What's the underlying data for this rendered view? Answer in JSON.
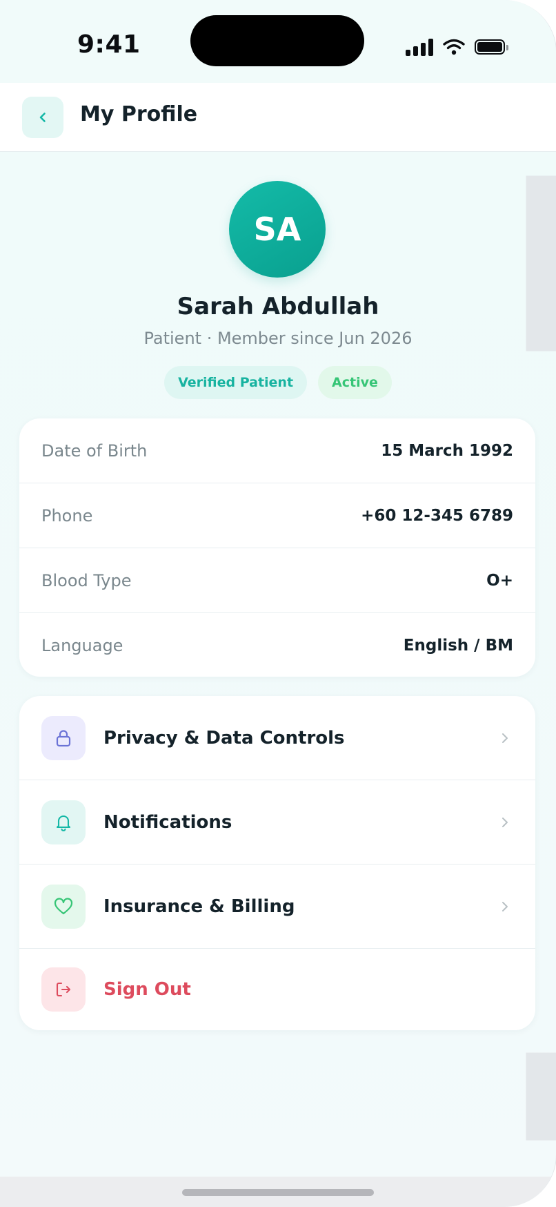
{
  "status_bar": {
    "time": "9:41"
  },
  "header": {
    "title": "My Profile"
  },
  "profile": {
    "initials": "SA",
    "name": "Sarah Abdullah",
    "subtitle": "Patient · Member since Jun 2026",
    "badges": {
      "verified": "Verified Patient",
      "active": "Active"
    }
  },
  "info": {
    "rows": [
      {
        "label": "Date of Birth",
        "value": "15 March 1992"
      },
      {
        "label": "Phone",
        "value": "+60 12-345 6789"
      },
      {
        "label": "Blood Type",
        "value": "O+"
      },
      {
        "label": "Language",
        "value": "English / BM"
      }
    ]
  },
  "menu": {
    "items": [
      {
        "label": "Privacy & Data Controls",
        "icon": "lock-icon"
      },
      {
        "label": "Notifications",
        "icon": "bell-icon"
      },
      {
        "label": "Insurance & Billing",
        "icon": "heart-icon"
      },
      {
        "label": "Sign Out",
        "icon": "sign-out-icon"
      }
    ]
  },
  "colors": {
    "accent": "#14b8a6",
    "verified_badge_text": "#17b3a0",
    "active_badge_text": "#36c576",
    "danger": "#dd4b5d",
    "privacy_icon": "#6b73d6"
  }
}
